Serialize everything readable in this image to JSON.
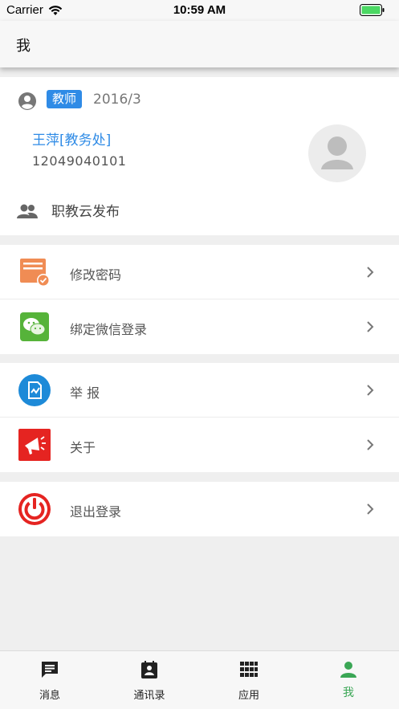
{
  "status_bar": {
    "carrier": "Carrier",
    "time": "10:59 AM"
  },
  "nav": {
    "title": "我"
  },
  "profile": {
    "role": "教师",
    "date": "2016/3",
    "name": "王萍[教务处]",
    "id": "12049040101",
    "publisher": "职教云发布"
  },
  "menu": {
    "change_password": "修改密码",
    "bind_wechat": "绑定微信登录",
    "report": "举 报",
    "about": "关于",
    "logout": "退出登录"
  },
  "tabs": [
    {
      "label": "消息",
      "icon": "message-icon"
    },
    {
      "label": "通讯录",
      "icon": "contacts-icon"
    },
    {
      "label": "应用",
      "icon": "apps-grid-icon"
    },
    {
      "label": "我",
      "icon": "person-icon",
      "active": true
    }
  ],
  "colors": {
    "accent": "#2f8be6",
    "active_tab": "#3aa655"
  }
}
